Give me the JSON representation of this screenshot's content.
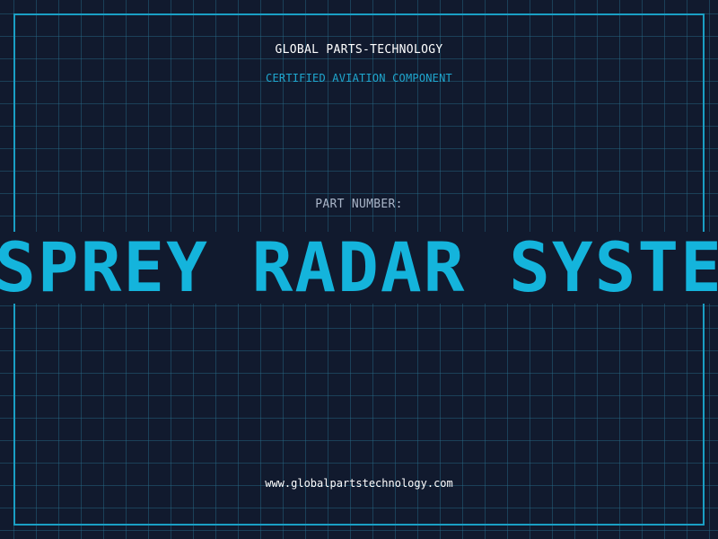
{
  "header": {
    "company": "GLOBAL PARTS-TECHNOLOGY",
    "subtitle": "CERTIFIED AVIATION COMPONENT"
  },
  "part": {
    "label": "PART NUMBER:",
    "name": "OSPREY RADAR SYSTEM"
  },
  "footer": {
    "url": "www.globalpartstechnology.com"
  },
  "colors": {
    "background": "#111a2e",
    "grid": "#286e8c",
    "accent": "#14b4dc",
    "frame": "#1a9fc4"
  }
}
